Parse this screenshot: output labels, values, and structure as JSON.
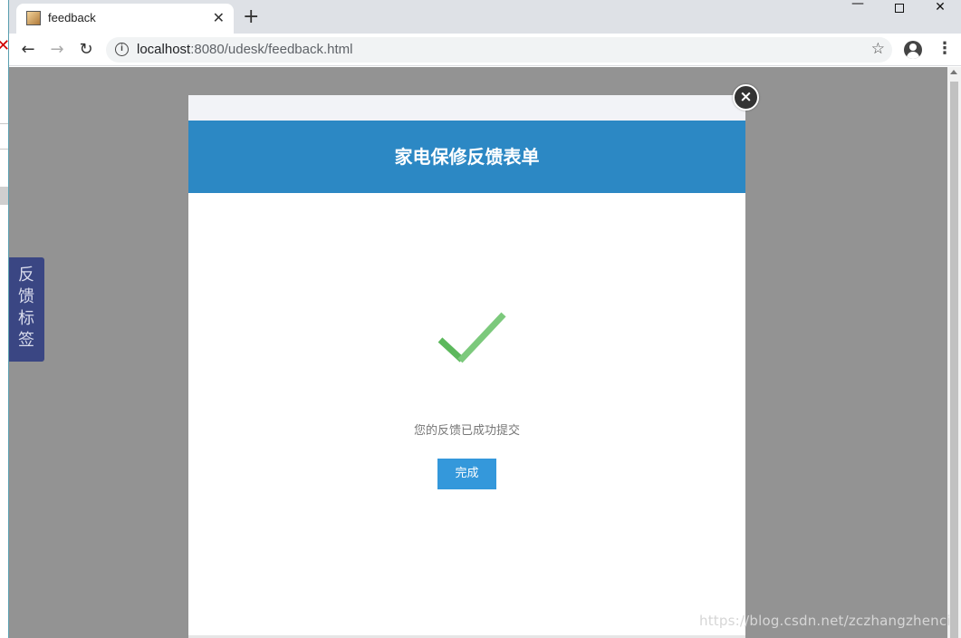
{
  "browser": {
    "tab_title": "feedback",
    "tab_close": "✕",
    "new_tab": "+",
    "url_host": "localhost",
    "url_path": ":8080/udesk/feedback.html",
    "window_min": "—",
    "window_close": "✕"
  },
  "sidebar_tab": {
    "chars": [
      "反",
      "馈",
      "标",
      "签"
    ]
  },
  "modal": {
    "title": "家电保修反馈表单",
    "message": "您的反馈已成功提交",
    "done_button": "完成",
    "close_glyph": "×"
  },
  "watermark": "https://blog.csdn.net/zczhangzhenci",
  "colors": {
    "header": "#2c88c4",
    "done_button": "#3498db",
    "check_green": "#5cb85c",
    "overlay": "#939393",
    "side_tab": "#3a4683"
  },
  "icons": [
    "back-arrow-icon",
    "forward-arrow-icon",
    "reload-icon",
    "info-icon",
    "star-icon",
    "account-icon",
    "menu-icon",
    "checkmark-icon",
    "close-icon"
  ]
}
